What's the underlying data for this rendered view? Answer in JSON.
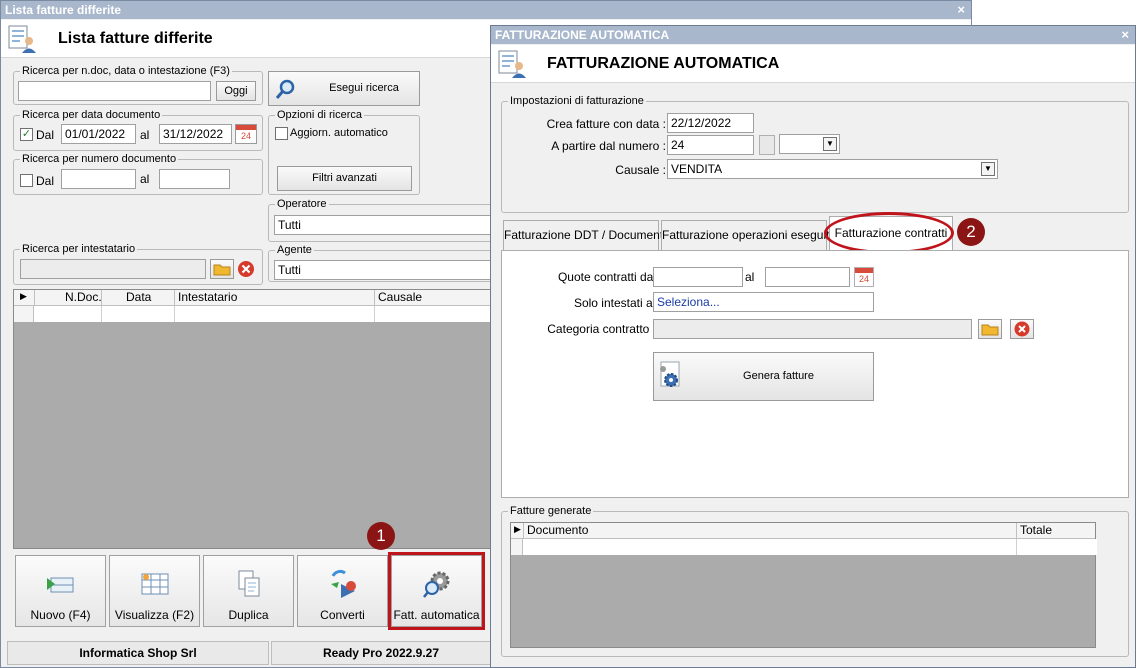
{
  "main_window": {
    "title": "Lista fatture differite",
    "close": "×",
    "header_title": "Lista fatture differite",
    "search_text_group": {
      "label": "Ricerca per n.doc, data o intestazione (F3)",
      "value": "",
      "ok_button": "Oggi"
    },
    "search_button": "Esegui ricerca",
    "date_group": {
      "label": "Ricerca per data documento",
      "dal_label": "Dal",
      "checked": true,
      "from": "01/01/2022",
      "al_label": "al",
      "to": "31/12/2022",
      "calendar_text": "24"
    },
    "options_group": {
      "label": "Opzioni di ricerca",
      "auto_update": "Aggiorn. automatico",
      "advanced_filters": "Filtri avanzati"
    },
    "number_group": {
      "label": "Ricerca per numero documento",
      "dal_label": "Dal",
      "al_label": "al",
      "from": "",
      "to": ""
    },
    "operator_group": {
      "label": "Operatore",
      "value": "Tutti"
    },
    "holder_group": {
      "label": "Ricerca per intestatario",
      "value": ""
    },
    "agent_group": {
      "label": "Agente",
      "value": "Tutti"
    },
    "grid_columns": [
      "N.Doc.",
      "Data",
      "Intestatario",
      "Causale"
    ],
    "grid_pointer": "▶",
    "toolbar": [
      {
        "label": "Nuovo (F4)",
        "icon": "new-document-icon"
      },
      {
        "label": "Visualizza (F2)",
        "icon": "view-grid-icon"
      },
      {
        "label": "Duplica",
        "icon": "duplicate-icon"
      },
      {
        "label": "Converti",
        "icon": "convert-icon"
      },
      {
        "label": "Fatt. automatica",
        "icon": "auto-invoice-gear-icon"
      }
    ],
    "status": {
      "company": "Informatica Shop Srl",
      "version": "Ready Pro 2022.9.27"
    }
  },
  "dialog": {
    "title": "FATTURAZIONE AUTOMATICA",
    "close": "×",
    "header_title": "FATTURAZIONE AUTOMATICA",
    "settings_group": {
      "label": "Impostazioni di fatturazione",
      "create_label": "Crea fatture con data :",
      "create_value": "22/12/2022",
      "start_number_label": "A partire dal numero :",
      "start_number_value": "24",
      "causale_label": "Causale :",
      "causale_value": "VENDITA"
    },
    "tabs": [
      {
        "label": "Fatturazione DDT / Documenti",
        "active": false
      },
      {
        "label": "Fatturazione operazioni eseguite",
        "active": false
      },
      {
        "label": "Fatturazione contratti",
        "active": true
      }
    ],
    "contracts": {
      "quote_label": "Quote contratti dal",
      "quote_from": "",
      "al_label": "al",
      "quote_to": "",
      "calendar_text": "24",
      "holders_label": "Solo intestati a:",
      "holders_value": "Seleziona...",
      "category_label": "Categoria contratto :",
      "category_value": "",
      "generate_button": "Genera fatture"
    },
    "generated_group": {
      "label": "Fatture generate",
      "columns": [
        "Documento",
        "Totale"
      ],
      "pointer": "▶"
    }
  },
  "annotations": {
    "badge_1": "1",
    "badge_2": "2",
    "highlight_color": "#c0141c"
  }
}
